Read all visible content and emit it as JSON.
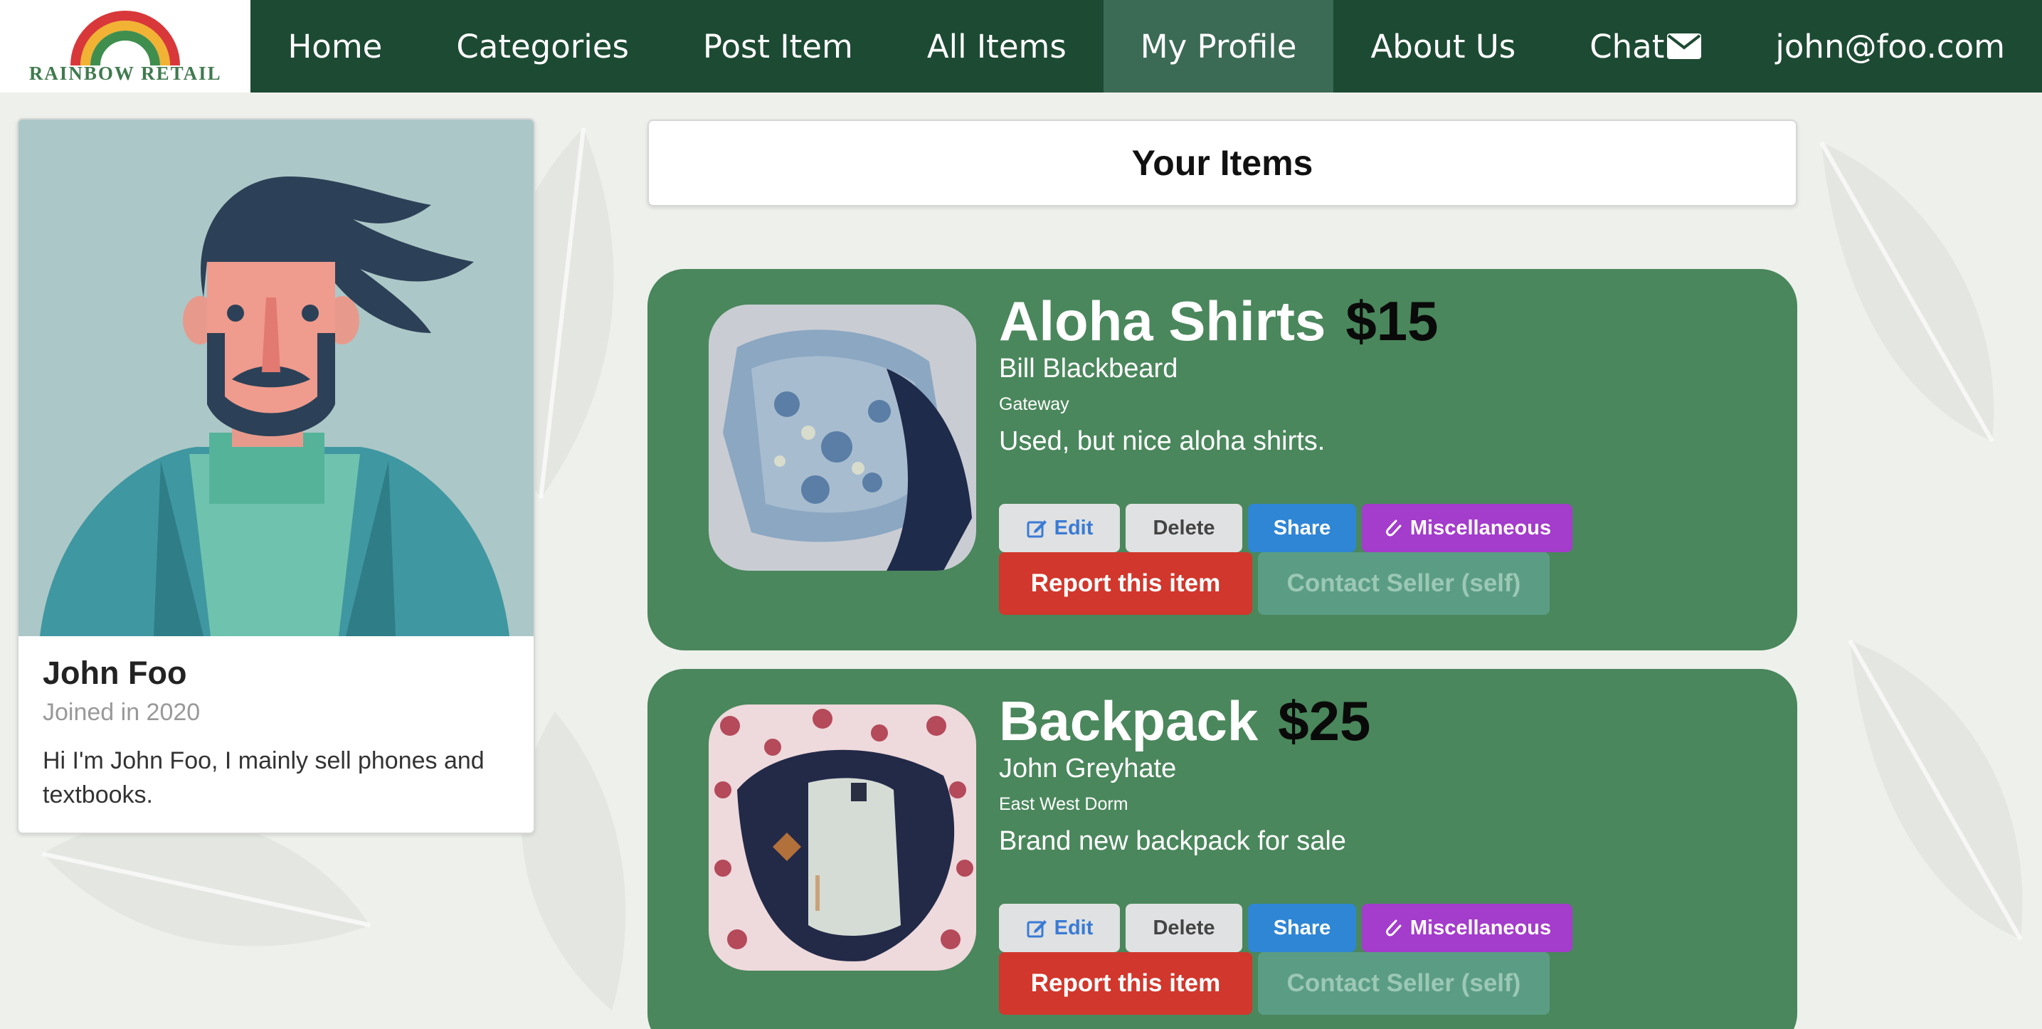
{
  "brand": {
    "logo_text": "RAINBOW RETAIL"
  },
  "nav": {
    "items": [
      {
        "label": "Home"
      },
      {
        "label": "Categories"
      },
      {
        "label": "Post Item"
      },
      {
        "label": "All Items"
      },
      {
        "label": "My Profile",
        "active": true
      },
      {
        "label": "About Us"
      },
      {
        "label": "Chat",
        "icon": "envelope-icon"
      },
      {
        "label": "john@foo.com"
      }
    ]
  },
  "profile": {
    "name": "John Foo",
    "joined": "Joined in 2020",
    "bio": "Hi I'm John Foo, I mainly sell phones and textbooks."
  },
  "items_header": {
    "title": "Your Items"
  },
  "items": [
    {
      "title": "Aloha Shirts",
      "price": "$15",
      "seller": "Bill Blackbeard",
      "location": "Gateway",
      "description": "Used, but nice aloha shirts.",
      "buttons": {
        "edit": "Edit",
        "delete": "Delete",
        "share": "Share",
        "category": "Miscellaneous",
        "report": "Report this item",
        "contact": "Contact Seller (self)"
      }
    },
    {
      "title": "Backpack",
      "price": "$25",
      "seller": "John Greyhate",
      "location": "East West Dorm",
      "description": "Brand new backpack for sale",
      "buttons": {
        "edit": "Edit",
        "delete": "Delete",
        "share": "Share",
        "category": "Miscellaneous",
        "report": "Report this item",
        "contact": "Contact Seller (self)"
      }
    }
  ],
  "colors": {
    "nav_bg": "#1d4a33",
    "nav_active": "#3b6a55",
    "card_green": "#4a875c",
    "report_red": "#d1372c",
    "misc_purple": "#a43ccc",
    "share_blue": "#2f86d5"
  }
}
